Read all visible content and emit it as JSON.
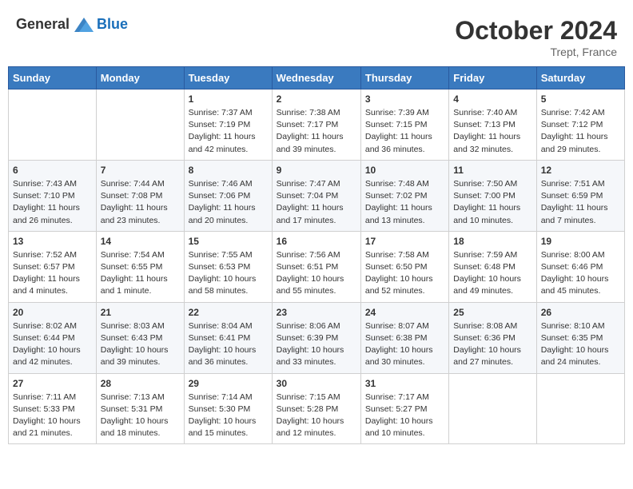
{
  "header": {
    "logo_general": "General",
    "logo_blue": "Blue",
    "month_year": "October 2024",
    "location": "Trept, France"
  },
  "weekdays": [
    "Sunday",
    "Monday",
    "Tuesday",
    "Wednesday",
    "Thursday",
    "Friday",
    "Saturday"
  ],
  "weeks": [
    [
      {
        "day": "",
        "info": ""
      },
      {
        "day": "",
        "info": ""
      },
      {
        "day": "1",
        "info": "Sunrise: 7:37 AM\nSunset: 7:19 PM\nDaylight: 11 hours and 42 minutes."
      },
      {
        "day": "2",
        "info": "Sunrise: 7:38 AM\nSunset: 7:17 PM\nDaylight: 11 hours and 39 minutes."
      },
      {
        "day": "3",
        "info": "Sunrise: 7:39 AM\nSunset: 7:15 PM\nDaylight: 11 hours and 36 minutes."
      },
      {
        "day": "4",
        "info": "Sunrise: 7:40 AM\nSunset: 7:13 PM\nDaylight: 11 hours and 32 minutes."
      },
      {
        "day": "5",
        "info": "Sunrise: 7:42 AM\nSunset: 7:12 PM\nDaylight: 11 hours and 29 minutes."
      }
    ],
    [
      {
        "day": "6",
        "info": "Sunrise: 7:43 AM\nSunset: 7:10 PM\nDaylight: 11 hours and 26 minutes."
      },
      {
        "day": "7",
        "info": "Sunrise: 7:44 AM\nSunset: 7:08 PM\nDaylight: 11 hours and 23 minutes."
      },
      {
        "day": "8",
        "info": "Sunrise: 7:46 AM\nSunset: 7:06 PM\nDaylight: 11 hours and 20 minutes."
      },
      {
        "day": "9",
        "info": "Sunrise: 7:47 AM\nSunset: 7:04 PM\nDaylight: 11 hours and 17 minutes."
      },
      {
        "day": "10",
        "info": "Sunrise: 7:48 AM\nSunset: 7:02 PM\nDaylight: 11 hours and 13 minutes."
      },
      {
        "day": "11",
        "info": "Sunrise: 7:50 AM\nSunset: 7:00 PM\nDaylight: 11 hours and 10 minutes."
      },
      {
        "day": "12",
        "info": "Sunrise: 7:51 AM\nSunset: 6:59 PM\nDaylight: 11 hours and 7 minutes."
      }
    ],
    [
      {
        "day": "13",
        "info": "Sunrise: 7:52 AM\nSunset: 6:57 PM\nDaylight: 11 hours and 4 minutes."
      },
      {
        "day": "14",
        "info": "Sunrise: 7:54 AM\nSunset: 6:55 PM\nDaylight: 11 hours and 1 minute."
      },
      {
        "day": "15",
        "info": "Sunrise: 7:55 AM\nSunset: 6:53 PM\nDaylight: 10 hours and 58 minutes."
      },
      {
        "day": "16",
        "info": "Sunrise: 7:56 AM\nSunset: 6:51 PM\nDaylight: 10 hours and 55 minutes."
      },
      {
        "day": "17",
        "info": "Sunrise: 7:58 AM\nSunset: 6:50 PM\nDaylight: 10 hours and 52 minutes."
      },
      {
        "day": "18",
        "info": "Sunrise: 7:59 AM\nSunset: 6:48 PM\nDaylight: 10 hours and 49 minutes."
      },
      {
        "day": "19",
        "info": "Sunrise: 8:00 AM\nSunset: 6:46 PM\nDaylight: 10 hours and 45 minutes."
      }
    ],
    [
      {
        "day": "20",
        "info": "Sunrise: 8:02 AM\nSunset: 6:44 PM\nDaylight: 10 hours and 42 minutes."
      },
      {
        "day": "21",
        "info": "Sunrise: 8:03 AM\nSunset: 6:43 PM\nDaylight: 10 hours and 39 minutes."
      },
      {
        "day": "22",
        "info": "Sunrise: 8:04 AM\nSunset: 6:41 PM\nDaylight: 10 hours and 36 minutes."
      },
      {
        "day": "23",
        "info": "Sunrise: 8:06 AM\nSunset: 6:39 PM\nDaylight: 10 hours and 33 minutes."
      },
      {
        "day": "24",
        "info": "Sunrise: 8:07 AM\nSunset: 6:38 PM\nDaylight: 10 hours and 30 minutes."
      },
      {
        "day": "25",
        "info": "Sunrise: 8:08 AM\nSunset: 6:36 PM\nDaylight: 10 hours and 27 minutes."
      },
      {
        "day": "26",
        "info": "Sunrise: 8:10 AM\nSunset: 6:35 PM\nDaylight: 10 hours and 24 minutes."
      }
    ],
    [
      {
        "day": "27",
        "info": "Sunrise: 7:11 AM\nSunset: 5:33 PM\nDaylight: 10 hours and 21 minutes."
      },
      {
        "day": "28",
        "info": "Sunrise: 7:13 AM\nSunset: 5:31 PM\nDaylight: 10 hours and 18 minutes."
      },
      {
        "day": "29",
        "info": "Sunrise: 7:14 AM\nSunset: 5:30 PM\nDaylight: 10 hours and 15 minutes."
      },
      {
        "day": "30",
        "info": "Sunrise: 7:15 AM\nSunset: 5:28 PM\nDaylight: 10 hours and 12 minutes."
      },
      {
        "day": "31",
        "info": "Sunrise: 7:17 AM\nSunset: 5:27 PM\nDaylight: 10 hours and 10 minutes."
      },
      {
        "day": "",
        "info": ""
      },
      {
        "day": "",
        "info": ""
      }
    ]
  ]
}
